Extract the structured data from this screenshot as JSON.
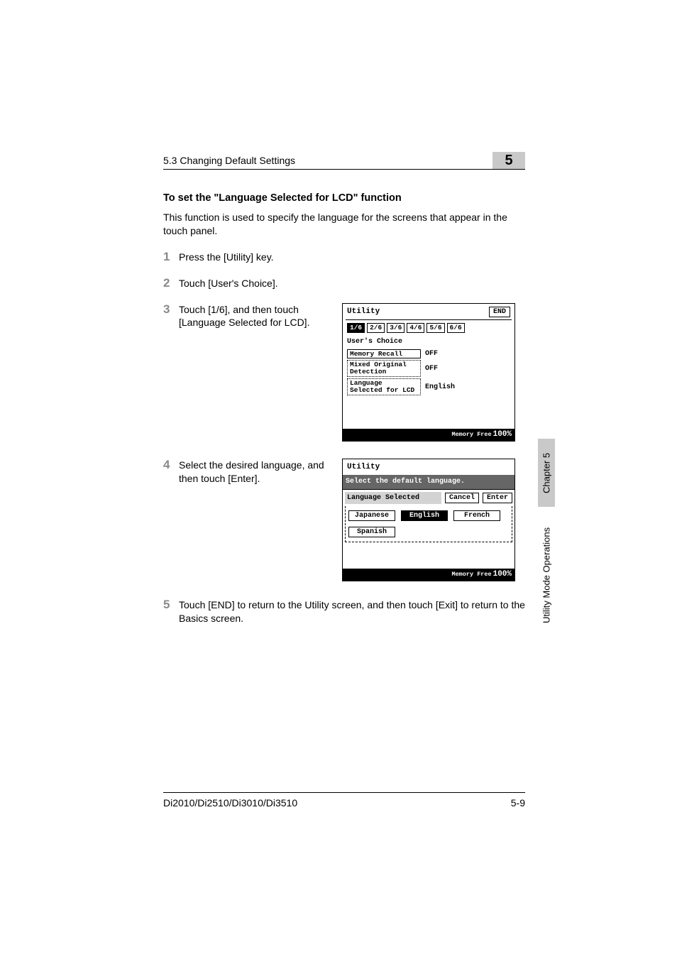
{
  "header": {
    "section": "5.3 Changing Default Settings",
    "chapter_num": "5"
  },
  "title": "To set the \"Language Selected for LCD\" function",
  "intro": "This function is used to specify the language for the screens that appear in the touch panel.",
  "steps": {
    "s1": {
      "num": "1",
      "text": "Press the [Utility] key."
    },
    "s2": {
      "num": "2",
      "text": "Touch [User's Choice]."
    },
    "s3": {
      "num": "3",
      "text": "Touch [1/6], and then touch [Language Selected for LCD]."
    },
    "s4": {
      "num": "4",
      "text": "Select the desired language, and then touch [Enter]."
    },
    "s5": {
      "num": "5",
      "text": "Touch [END] to return to the Utility screen, and then touch [Exit] to return to the Basics screen."
    }
  },
  "lcd1": {
    "title": "Utility",
    "end": "END",
    "tabs": [
      "1/6",
      "2/6",
      "3/6",
      "4/6",
      "5/6",
      "6/6"
    ],
    "subhead": "User's Choice",
    "rows": [
      {
        "label": "Memory Recall",
        "value": "OFF"
      },
      {
        "label": "Mixed Original Detection",
        "value": "OFF"
      },
      {
        "label": "Language Selected for LCD",
        "value": "English"
      }
    ],
    "mem_label": "Memory Free",
    "mem_pct": "100%"
  },
  "lcd2": {
    "title": "Utility",
    "banner": "Select the default language.",
    "head_label": "Language Selected",
    "cancel": "Cancel",
    "enter": "Enter",
    "langs": [
      "Japanese",
      "English",
      "French",
      "Spanish"
    ],
    "selected": "English",
    "mem_label": "Memory Free",
    "mem_pct": "100%"
  },
  "footer": {
    "left": "Di2010/Di2510/Di3010/Di3510",
    "right": "5-9"
  },
  "sidetab": {
    "chapter": "Chapter 5",
    "title": "Utility Mode Operations"
  }
}
